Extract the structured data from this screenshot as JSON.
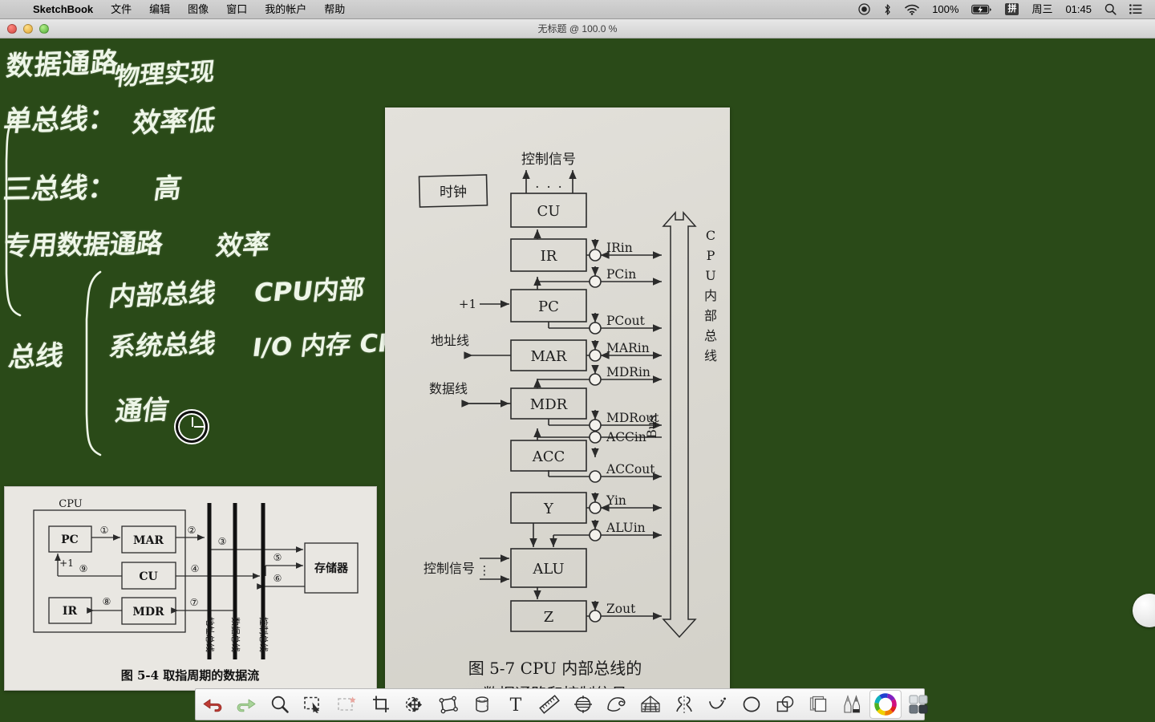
{
  "menubar": {
    "apple_icon": "apple-logo-icon",
    "app_name": "SketchBook",
    "items": [
      "文件",
      "编辑",
      "图像",
      "窗口",
      "我的帐户",
      "帮助"
    ],
    "status": {
      "record_icon": "screen-record-icon",
      "bluetooth_icon": "bluetooth-icon",
      "wifi_icon": "wifi-icon",
      "battery_percent": "100%",
      "battery_icon": "battery-charging-icon",
      "input_method": "拼",
      "day": "周三",
      "time": "01:45",
      "search_icon": "spotlight-search-icon",
      "control_center_icon": "notification-center-icon"
    }
  },
  "window": {
    "title": "无标题 @ 100.0 %",
    "close_label": "关闭",
    "minimize_label": "最小化",
    "zoom_label": "缩放"
  },
  "canvas": {
    "background_color": "#2a4a18",
    "ink_color": "#eef6e8",
    "notes": [
      "数据通路",
      "物理实现",
      "单总线：",
      "效率低",
      "三总线：",
      "高",
      "专用数据通路",
      "效率",
      "总线",
      "内部总线",
      "CPU内部",
      "系统总线",
      "I/O 内存 CPU",
      "通信"
    ],
    "cursor": "brush-crosshair-cursor",
    "puck": "lagoon-puck-control"
  },
  "figure_57": {
    "title_line1": "图 5-7   CPU 内部总线的",
    "title_line2": "数据通路和控制信号",
    "blocks": [
      "时钟",
      "CU",
      "IR",
      "PC",
      "MAR",
      "MDR",
      "ACC",
      "Y",
      "ALU",
      "Z"
    ],
    "top_label": "控制信号",
    "dots": ". . .",
    "pc_increment": "+1",
    "left_labels": [
      "地址线",
      "数据线",
      "控制信号"
    ],
    "control_signals": [
      "IRin",
      "PCin",
      "PCout",
      "MARin",
      "MDRin",
      "MDRout",
      "ACCin",
      "ACCout",
      "Yin",
      "ALUin",
      "Zout"
    ],
    "bus_label": "Bus",
    "bus_side_label": "CPU 内部总线",
    "bus_side_chars": [
      "C",
      "P",
      "U",
      "内",
      "部",
      "总",
      "线"
    ],
    "alu_ctrl_dots": "⋮"
  },
  "figure_54": {
    "caption": "图 5-4    取指周期的数据流",
    "cpu_label": "CPU",
    "blocks": [
      "PC",
      "MAR",
      "CU",
      "IR",
      "MDR",
      "存储器"
    ],
    "pc_increment": "+1",
    "steps": [
      "①",
      "②",
      "③",
      "④",
      "⑤",
      "⑥",
      "⑦",
      "⑧",
      "⑨"
    ],
    "bus_labels": [
      "地址总线",
      "数据总线",
      "控制总线"
    ]
  },
  "toolbar": {
    "buttons": [
      {
        "name": "undo-button",
        "label": "撤销",
        "icon": "undo-arrow-icon"
      },
      {
        "name": "redo-button",
        "label": "重做",
        "icon": "redo-arrow-icon"
      },
      {
        "name": "zoom-tool-button",
        "label": "缩放",
        "icon": "magnifier-icon"
      },
      {
        "name": "select-tool-button",
        "label": "选择",
        "icon": "marquee-select-icon"
      },
      {
        "name": "deselect-tool-button",
        "label": "取消选择",
        "icon": "marquee-deselect-icon"
      },
      {
        "name": "crop-tool-button",
        "label": "裁剪",
        "icon": "crop-icon"
      },
      {
        "name": "transform-tool-button",
        "label": "变换",
        "icon": "move-transform-icon"
      },
      {
        "name": "distort-tool-button",
        "label": "扭曲",
        "icon": "distort-quad-icon"
      },
      {
        "name": "fill-tool-button",
        "label": "填充",
        "icon": "paint-bucket-icon"
      },
      {
        "name": "text-tool-button",
        "label": "文字",
        "icon": "text-T-icon"
      },
      {
        "name": "ruler-tool-button",
        "label": "直尺",
        "icon": "ruler-icon"
      },
      {
        "name": "ellipse-guide-button",
        "label": "椭圆导向",
        "icon": "ellipse-guide-icon"
      },
      {
        "name": "french-curve-button",
        "label": "曲线板",
        "icon": "french-curve-icon"
      },
      {
        "name": "perspective-guide-button",
        "label": "透视导向",
        "icon": "perspective-grid-icon"
      },
      {
        "name": "symmetry-button",
        "label": "对称",
        "icon": "symmetry-mirror-icon"
      },
      {
        "name": "predictive-stroke-button",
        "label": "笔触预测",
        "icon": "predictive-stroke-icon"
      },
      {
        "name": "shape-ellipse-button",
        "label": "椭圆形状",
        "icon": "ellipse-shape-icon"
      },
      {
        "name": "shape-combine-button",
        "label": "形状组合",
        "icon": "shape-combine-icon"
      },
      {
        "name": "layers-button",
        "label": "图层",
        "icon": "layers-icon"
      },
      {
        "name": "brush-palette-button",
        "label": "画笔",
        "icon": "brushes-icon"
      },
      {
        "name": "color-wheel-button",
        "label": "颜色",
        "icon": "color-wheel-icon"
      },
      {
        "name": "swatches-button",
        "label": "色板",
        "icon": "swatches-grid-icon"
      }
    ]
  }
}
